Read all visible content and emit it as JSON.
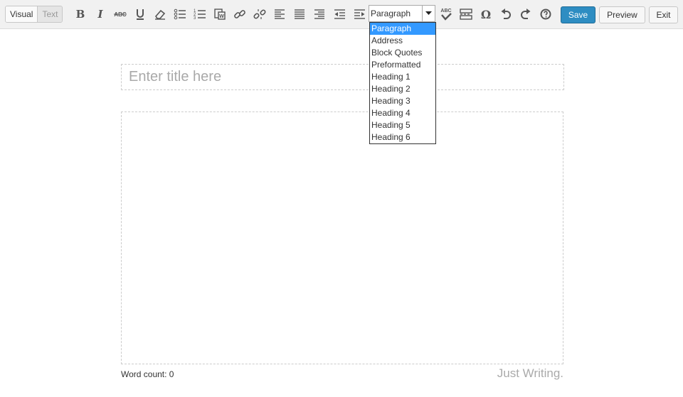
{
  "editor_modes": {
    "visual": "Visual",
    "text": "Text"
  },
  "toolbar": {
    "icons": [
      "bold-icon",
      "italic-icon",
      "strikethrough-icon",
      "underline-icon",
      "eraser-icon",
      "bullet-list-icon",
      "numbered-list-icon",
      "paste-word-icon",
      "link-icon",
      "unlink-icon",
      "align-left-icon",
      "align-justify-icon",
      "align-right-icon",
      "outdent-icon",
      "indent-icon",
      "spellcheck-icon",
      "more-tag-icon",
      "omega-icon",
      "undo-icon",
      "redo-icon",
      "help-icon"
    ],
    "strike_text": "ABC",
    "spell_text": "ABC",
    "omega": "Ω"
  },
  "format_select": {
    "selected": "Paragraph",
    "options": [
      "Paragraph",
      "Address",
      "Block Quotes",
      "Preformatted",
      "Heading 1",
      "Heading 2",
      "Heading 3",
      "Heading 4",
      "Heading 5",
      "Heading 6"
    ]
  },
  "actions": {
    "save": "Save",
    "preview": "Preview",
    "exit": "Exit"
  },
  "title": {
    "placeholder": "Enter title here",
    "value": ""
  },
  "status": {
    "word_count": "Word count: 0",
    "tagline": "Just Writing."
  },
  "colors": {
    "accent": "#2e8dc2",
    "highlight": "#3399ff"
  }
}
